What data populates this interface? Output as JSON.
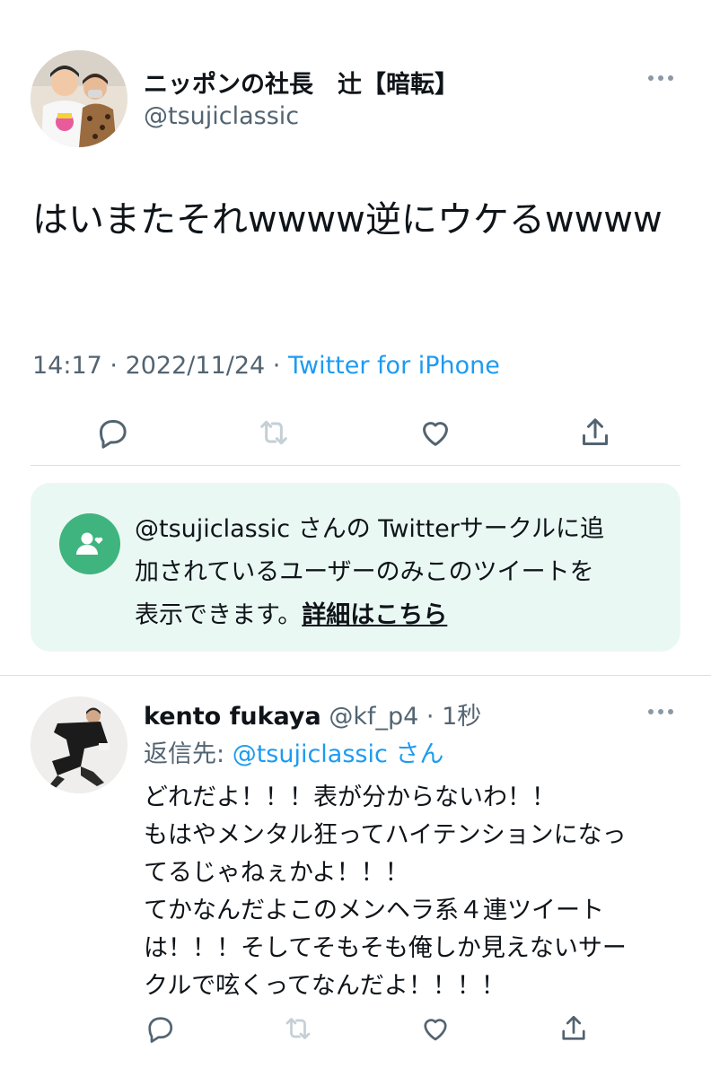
{
  "tweet": {
    "display_name": "ニッポンの社長　辻【暗転】",
    "handle": "@tsujiclassic",
    "text": "はいまたそれwwww逆にウケるwwww",
    "time": "14:17",
    "date": "2022/11/24",
    "source": "Twitter for iPhone"
  },
  "circle_notice": {
    "lines": [
      "@tsujiclassic さんの Twitterサークルに追",
      "加されているユーザーのみこのツイートを",
      "表示できます。"
    ],
    "link": "詳細はこちら",
    "color": "#3fb47e",
    "bg": "#eaf8f3"
  },
  "reply": {
    "name": "kento fukaya",
    "handle": "@kf_p4",
    "time": "1秒",
    "reply_to_prefix": "返信先: ",
    "reply_to_handle": "@tsujiclassic",
    "reply_to_suffix": "さん",
    "lines": [
      "どれだよ！！！表が分からないわ！！",
      "もはやメンタル狂ってハイテンションになっ",
      "てるじゃねぇかよ！！！",
      "てかなんだよこのメンヘラ系４連ツイート",
      "は！！！そしてそもそも俺しか見えないサー",
      "クルで呟くってなんだよ！！！！"
    ]
  },
  "actions": [
    "reply-icon",
    "retweet-icon",
    "like-icon",
    "share-icon"
  ],
  "colors": {
    "link": "#1d9bf0",
    "secondary": "#536471",
    "text": "#0f1419"
  }
}
